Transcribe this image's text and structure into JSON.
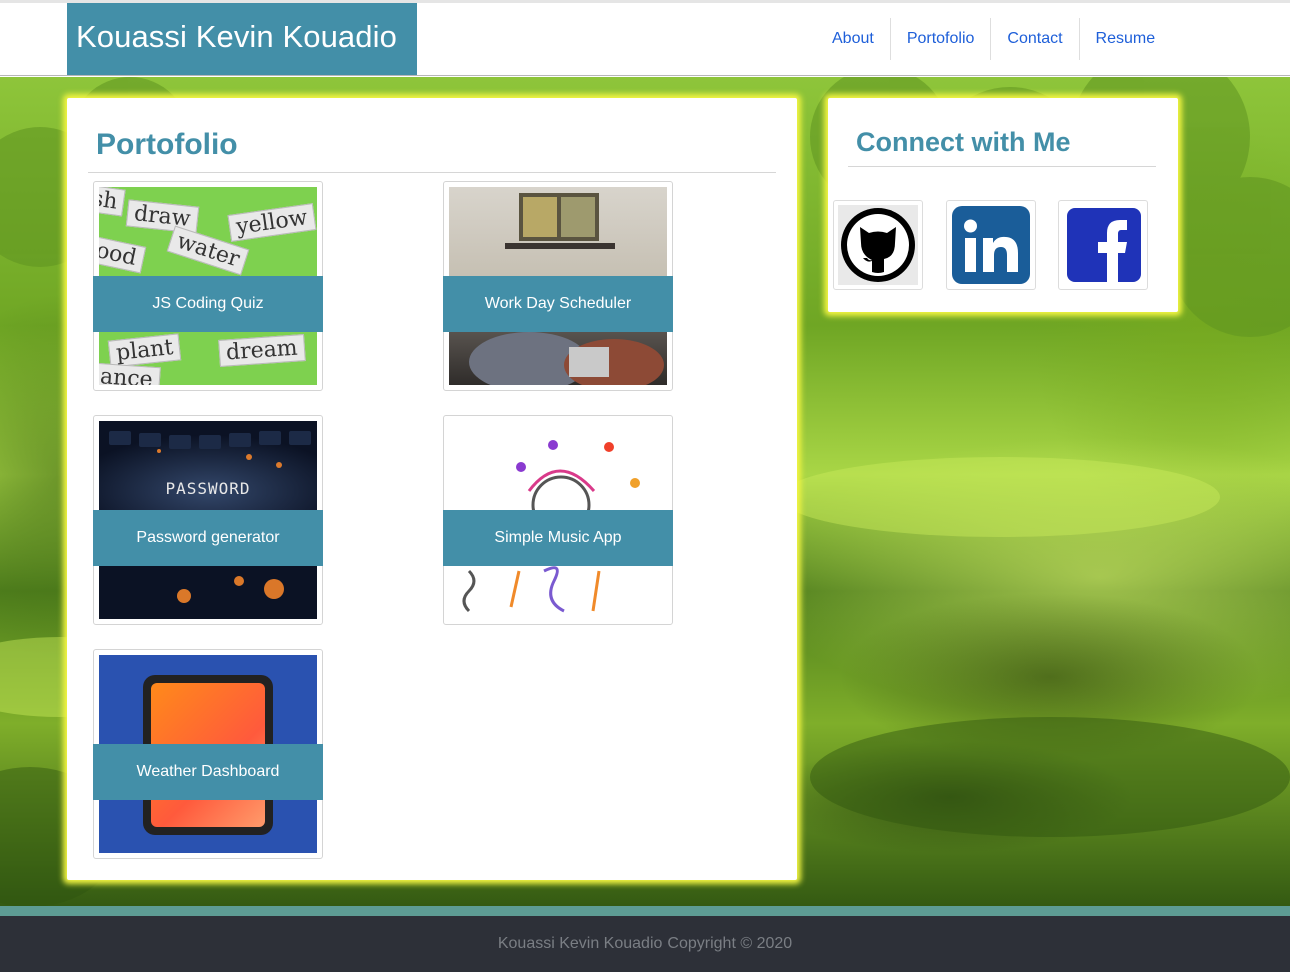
{
  "header": {
    "brand": "Kouassi Kevin Kouadio",
    "nav": [
      {
        "label": "About"
      },
      {
        "label": "Portofolio"
      },
      {
        "label": "Contact"
      },
      {
        "label": "Resume"
      }
    ]
  },
  "portfolio": {
    "title": "Portofolio",
    "projects": [
      {
        "label": "JS Coding Quiz"
      },
      {
        "label": "Work Day Scheduler"
      },
      {
        "label": "Password generator",
        "thumb_text": "PASSWORD"
      },
      {
        "label": "Simple Music App"
      },
      {
        "label": "Weather Dashboard"
      }
    ],
    "quiz_words": [
      "draw",
      "yellow",
      "water",
      "ood",
      "plant",
      "dream",
      "ance",
      "sh"
    ]
  },
  "connect": {
    "title": "Connect with Me",
    "links": [
      {
        "icon": "github-icon"
      },
      {
        "icon": "linkedin-icon"
      },
      {
        "icon": "facebook-icon"
      }
    ]
  },
  "footer": {
    "name": "Kouassi Kevin Kouadio",
    "copyright": "Copyright © 2020"
  },
  "colors": {
    "accent": "#438fa8",
    "nav_link": "#1e5fd9",
    "panel_glow": "#f2f542",
    "footer_bg": "#2d3038",
    "footer_stripe": "#5d9c94"
  }
}
